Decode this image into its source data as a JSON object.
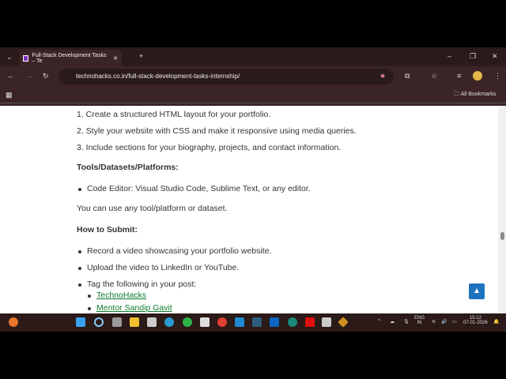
{
  "browser": {
    "tab_title": "Full-Stack Development Tasks – Te",
    "url": "technohacks.co.in/full-stack-development-tasks-internship/",
    "bookmarks_label": "All Bookmarks"
  },
  "content": {
    "steps": [
      "1. Create a structured HTML layout for your portfolio.",
      "2. Style your website with CSS and make it responsive using media queries.",
      "3. Include sections for your biography, projects, and contact information."
    ],
    "tools_heading": "Tools/Datasets/Platforms:",
    "tools_item": "Code Editor: Visual Studio Code, Sublime Text, or any editor.",
    "tools_note": "You can use any tool/platform or dataset.",
    "submit_heading": "How to Submit:",
    "submit_items": [
      "Record a video showcasing your portfolio website.",
      "Upload the video to LinkedIn or YouTube.",
      "Tag the following in your post:"
    ],
    "tags": [
      "TechnoHacks",
      "Mentor Sandip Gavit"
    ]
  },
  "taskbar": {
    "lang": "ENG",
    "region": "IN",
    "time": "15:12",
    "date": "07-01-2026"
  }
}
